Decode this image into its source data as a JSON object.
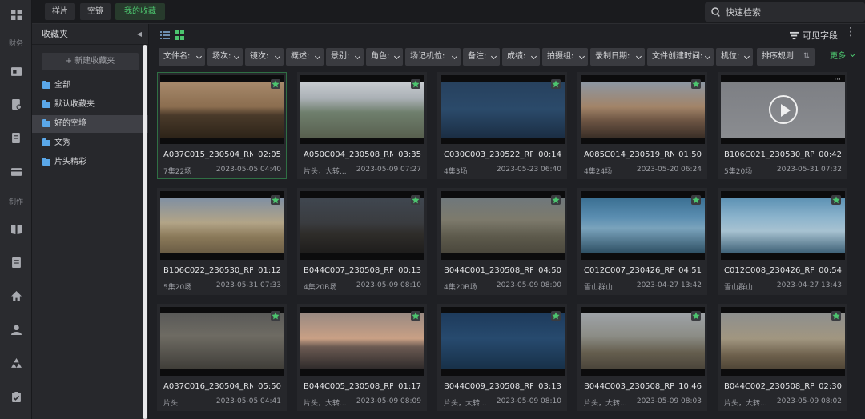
{
  "rail": {
    "label_finance": "财务",
    "label_production": "制作"
  },
  "topbar": {
    "tabs": [
      {
        "label": "样片",
        "active": false
      },
      {
        "label": "空镜",
        "active": false
      },
      {
        "label": "我的收藏",
        "active": true
      }
    ],
    "search_placeholder": "快速检索"
  },
  "panel": {
    "title": "收藏夹",
    "new_button": "+ 新建收藏夹",
    "folders": [
      {
        "label": "全部",
        "active": false
      },
      {
        "label": "默认收藏夹",
        "active": false
      },
      {
        "label": "好的空境",
        "active": true
      },
      {
        "label": "文秀",
        "active": false
      },
      {
        "label": "片头精彩",
        "active": false
      }
    ]
  },
  "toolbar": {
    "visible_fields": "可见字段",
    "more_label": "更多"
  },
  "filters": [
    "文件名:",
    "场次:",
    "镜次:",
    "概述:",
    "景别:",
    "角色:",
    "场记机位:",
    "备注:",
    "成绩:",
    "拍摄组:",
    "录制日期:",
    "文件创建时间:",
    "机位:",
    "排序规则"
  ],
  "clips": [
    {
      "title": "A037C015_230504_RNU...",
      "duration": "02:05",
      "tag": "7集22场",
      "date": "2023-05-05 04:40",
      "scene": "dusk"
    },
    {
      "title": "A050C004_230508_RNU...",
      "duration": "03:35",
      "tag": "片头，大转...",
      "date": "2023-05-09 07:27",
      "scene": "plain"
    },
    {
      "title": "C030C003_230522_RPG...",
      "duration": "00:14",
      "tag": "4集3场",
      "date": "2023-05-23 06:40",
      "scene": "night"
    },
    {
      "title": "A085C014_230519_RNU...",
      "duration": "01:50",
      "tag": "4集24场",
      "date": "2023-05-20 06:24",
      "scene": "camp"
    },
    {
      "title": "B106C021_230530_RPL9",
      "duration": "00:42",
      "tag": "5集20场",
      "date": "2023-05-31 07:32",
      "scene": "grey"
    },
    {
      "title": "B106C022_230530_RPL9",
      "duration": "01:12",
      "tag": "5集20场",
      "date": "2023-05-31 07:33",
      "scene": "yurt"
    },
    {
      "title": "B044C007_230508_RPL...",
      "duration": "00:13",
      "tag": "4集20B场",
      "date": "2023-05-09 08:10",
      "scene": "dark"
    },
    {
      "title": "B044C001_230508_RPL...",
      "duration": "04:50",
      "tag": "4集20B场",
      "date": "2023-05-09 08:00",
      "scene": "herd"
    },
    {
      "title": "C012C007_230426_RPGI...",
      "duration": "04:51",
      "tag": "雪山群山",
      "date": "2023-04-27 13:42",
      "scene": "snow"
    },
    {
      "title": "C012C008_230426_RPGI...",
      "duration": "00:54",
      "tag": "雪山群山",
      "date": "2023-04-27 13:43",
      "scene": "snow2"
    },
    {
      "title": "A037C016_230504_RNU...",
      "duration": "05:50",
      "tag": "片头",
      "date": "2023-05-05 04:41",
      "scene": "clap"
    },
    {
      "title": "B044C005_230508_RPL...",
      "duration": "01:17",
      "tag": "片头，大转...",
      "date": "2023-05-09 08:09",
      "scene": "sunset"
    },
    {
      "title": "B044C009_230508_RPL...",
      "duration": "03:13",
      "tag": "片头，大转...",
      "date": "2023-05-09 08:10",
      "scene": "lake"
    },
    {
      "title": "B044C003_230508_RPL...",
      "duration": "10:46",
      "tag": "片头，大转...",
      "date": "2023-05-09 08:03",
      "scene": "rider"
    },
    {
      "title": "B044C002_230508_RPL...",
      "duration": "02:30",
      "tag": "片头，大转...",
      "date": "2023-05-09 08:02",
      "scene": "rider2"
    }
  ],
  "colors": {
    "accent": "#4cc46e",
    "folder": "#5aa7e8"
  }
}
